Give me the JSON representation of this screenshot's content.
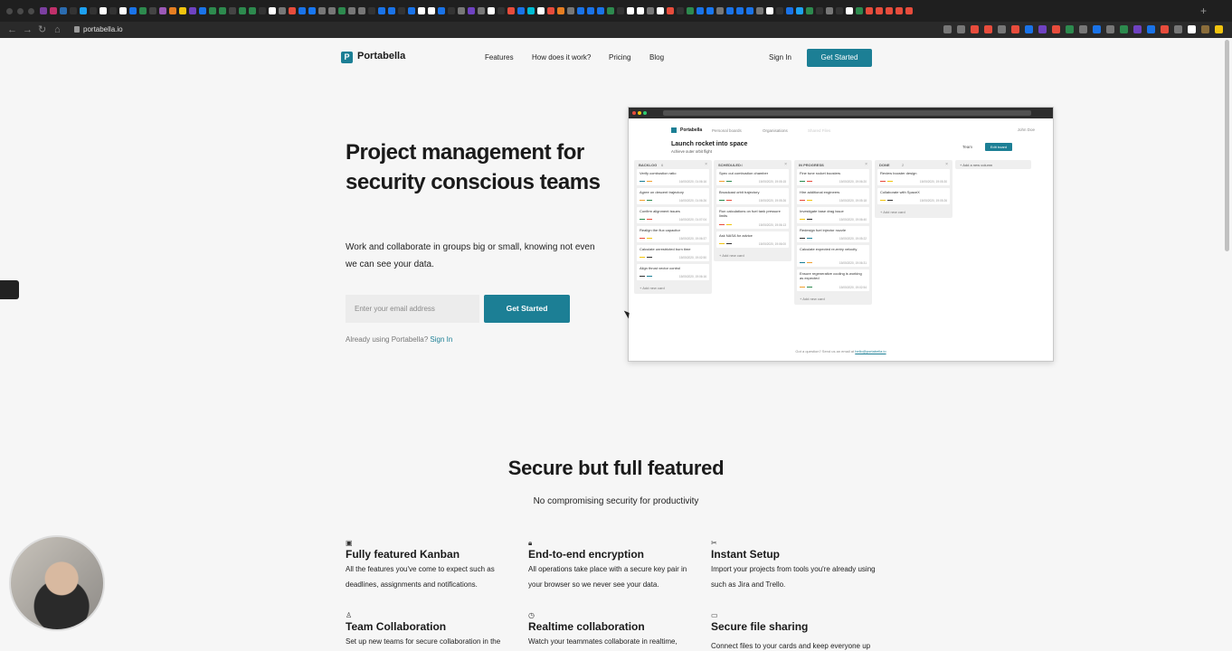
{
  "browser": {
    "url": "portabella.io",
    "tab_icon_colors": [
      "#7b3fa0",
      "#c0306a",
      "#2b6cb0",
      "#333",
      "#1da1f2",
      "#333",
      "#fff",
      "#333",
      "#fff",
      "#1a73e8",
      "#2d8a4e",
      "#444",
      "#9b59b6",
      "#e67e22",
      "#f1c40f",
      "#6f42c1",
      "#1a73e8",
      "#2d8a4e",
      "#2d8a4e",
      "#444",
      "#2d8a4e",
      "#2d8a4e",
      "#333",
      "#fff",
      "#777",
      "#e74c3c",
      "#1a73e8",
      "#1877f2",
      "#777",
      "#777",
      "#2d8a4e",
      "#777",
      "#777",
      "#333",
      "#1a73e8",
      "#1a73e8",
      "#333",
      "#1a73e8",
      "#fff",
      "#fff",
      "#1a73e8",
      "#333",
      "#777",
      "#6f42c1",
      "#777",
      "#fff",
      "#333",
      "#e74c3c",
      "#1a73e8",
      "#00bcd4",
      "#fff",
      "#e74c3c",
      "#e67e22",
      "#777",
      "#1a73e8",
      "#1a73e8",
      "#1a73e8",
      "#2d8a4e",
      "#333",
      "#fff",
      "#fff",
      "#777",
      "#fff",
      "#e74c3c",
      "#333",
      "#2d8a4e",
      "#1a73e8",
      "#1877f2",
      "#777",
      "#1a73e8",
      "#1a73e8",
      "#1a73e8",
      "#777",
      "#fff",
      "#333",
      "#1a73e8",
      "#1da1f2",
      "#2d8a4e",
      "#333",
      "#777",
      "#333",
      "#fff",
      "#2d8a4e",
      "#e74c3c",
      "#e74c3c",
      "#e74c3c",
      "#e74c3c",
      "#e74c3c"
    ],
    "ext_icon_colors": [
      "#777",
      "#777",
      "#e74c3c",
      "#e74c3c",
      "#777",
      "#e74c3c",
      "#1a73e8",
      "#6f42c1",
      "#e74c3c",
      "#2d8a4e",
      "#777",
      "#1a73e8",
      "#777",
      "#2d8a4e",
      "#6f42c1",
      "#1a73e8",
      "#e74c3c",
      "#777",
      "#fff",
      "#8a6d3b",
      "#f1c40f"
    ]
  },
  "nav": {
    "brand": "Portabella",
    "logo_letter": "P",
    "links": [
      "Features",
      "How does it work?",
      "Pricing",
      "Blog"
    ],
    "sign_in": "Sign In",
    "get_started": "Get Started"
  },
  "hero": {
    "title": "Project management for security conscious teams",
    "subtitle": "Work and collaborate in groups big or small, knowing not even we can see your data.",
    "email_placeholder": "Enter your email address",
    "cta": "Get Started",
    "already_text": "Already using Portabella?",
    "already_link": "Sign In"
  },
  "mock": {
    "brand": "Portabella",
    "nav": [
      "Personal boards",
      "Organisations",
      "Shared Files"
    ],
    "user": "John Doe",
    "board_title": "Launch rocket into space",
    "board_sub": "Achieve outer orbit flight",
    "team": "Team",
    "edit_board": "Edit board",
    "add_column": "+ Add a new column",
    "add_card": "+ Add new card",
    "footer_text": "Got a question? Send us an email at",
    "footer_email": "hello@portabella.io",
    "columns": [
      {
        "name": "BACKLOG",
        "count": "6",
        "cards": [
          {
            "title": "Verify combustion ratio",
            "date": "16/05/2020, 01:06:16"
          },
          {
            "title": "Agree on descent trajectory",
            "date": "16/05/2020, 01:06:26"
          },
          {
            "title": "Confirm alignment issues",
            "date": "16/05/2020, 01:07:04"
          },
          {
            "title": "Realign the flux capacitor",
            "date": "15/05/2020, 19:06:37"
          },
          {
            "title": "Calculate unrestricted burn time",
            "date": "15/05/2020, 19:02:50"
          },
          {
            "title": "Align thrust vector control",
            "date": "15/05/2020, 19:06:16"
          }
        ]
      },
      {
        "name": "SCHEDULED",
        "count": "4",
        "cards": [
          {
            "title": "Spec out combustion chamber",
            "date": "15/05/2020, 19:05:15"
          },
          {
            "title": "Broadcast orbit trajectory",
            "date": "15/05/2020, 19:05:26"
          },
          {
            "title": "Run calculations on fuel tank pressure limits",
            "date": "15/05/2020, 19:06:13"
          },
          {
            "title": "Ask NASA for advice",
            "date": "15/05/2020, 19:06:00"
          }
        ]
      },
      {
        "name": "IN PROGRESS",
        "count": "6",
        "cards": [
          {
            "title": "Fine tune rocket boosters",
            "date": "15/05/2020, 19:06:20"
          },
          {
            "title": "Hire additional engineers",
            "date": "15/05/2020, 19:05:18"
          },
          {
            "title": "Investigate base drag issue",
            "date": "15/05/2020, 19:06:40"
          },
          {
            "title": "Redesign fuel injector nozzle",
            "date": "15/05/2020, 19:05:22"
          },
          {
            "title": "Calculate expected re-entry velocity",
            "date": "15/05/2020, 19:06:31"
          },
          {
            "title": "Ensure regenerative cooling is working as expected",
            "date": "15/05/2020, 19:02:54"
          }
        ]
      },
      {
        "name": "DONE",
        "count": "2",
        "cards": [
          {
            "title": "Review booster design",
            "date": "15/05/2020, 19:05:30"
          },
          {
            "title": "Collaborate with SpaceX",
            "date": "15/05/2020, 19:05:26"
          }
        ]
      }
    ]
  },
  "features": {
    "title": "Secure but full featured",
    "subtitle": "No compromising security for productivity",
    "items": [
      {
        "icon": "kanban-icon",
        "glyph": "▣",
        "title": "Fully featured Kanban",
        "desc": "All the features you've come to expect such as deadlines, assignments and notifications."
      },
      {
        "icon": "lock-icon",
        "glyph": "🔒︎",
        "title": "End-to-end encryption",
        "desc": "All operations take place with a secure key pair in your browser so we never see your data."
      },
      {
        "icon": "tools-icon",
        "glyph": "✂",
        "title": "Instant Setup",
        "desc": "Import your projects from tools you're already using such as Jira and Trello."
      },
      {
        "icon": "team-icon",
        "glyph": "♙",
        "title": "Team Collaboration",
        "desc": "Set up new teams for secure collaboration in the"
      },
      {
        "icon": "clock-icon",
        "glyph": "◷",
        "title": "Realtime collaboration",
        "desc": "Watch your teammates collaborate in realtime,"
      },
      {
        "icon": "folder-icon",
        "glyph": "▭",
        "title": "Secure file sharing",
        "desc": "Connect files to your cards and keep everyone up"
      }
    ]
  },
  "colors": {
    "accent": "#1c7f95",
    "tag_colors": [
      "#1c7f95",
      "#f0a030",
      "#2d8a4e",
      "#e74c3c",
      "#f1c40f",
      "#333333"
    ]
  }
}
